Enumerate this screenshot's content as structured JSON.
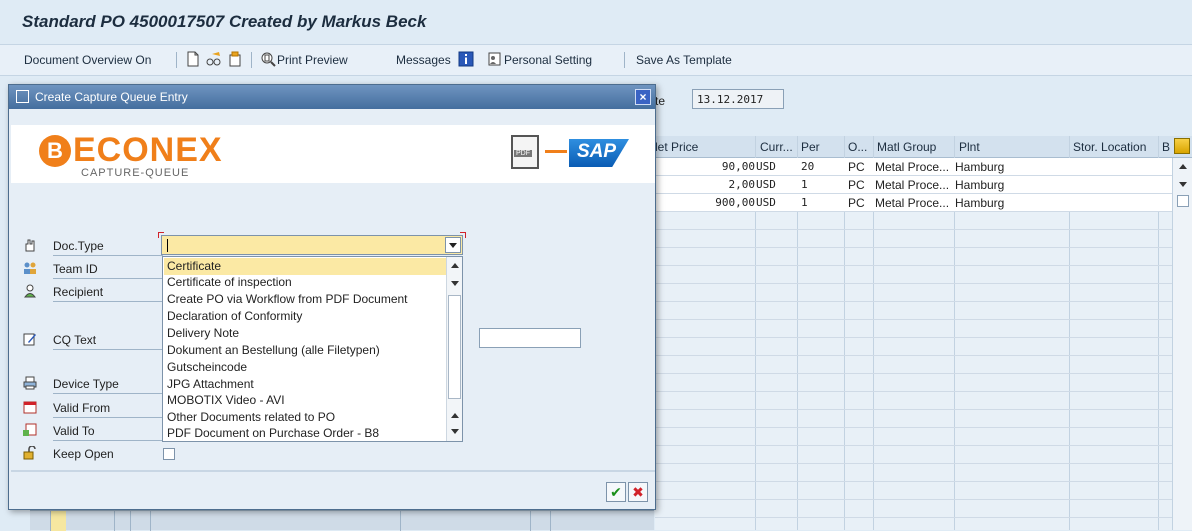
{
  "window": {
    "title": "Standard PO 4500017507 Created by Markus Beck"
  },
  "toolbar": {
    "document_overview": "Document Overview On",
    "print_preview": "Print Preview",
    "messages": "Messages",
    "personal_setting": "Personal Setting",
    "save_as_template": "Save As Template"
  },
  "background": {
    "date_label": "te",
    "date_value": "13.12.2017",
    "grid": {
      "headers": [
        "let Price",
        "Curr...",
        "Per",
        "O...",
        "Matl Group",
        "Plnt",
        "Stor. Location",
        "B"
      ],
      "rows": [
        [
          "90,00",
          "USD",
          "20",
          "PC",
          "Metal Proce...",
          "Hamburg",
          ""
        ],
        [
          "2,00",
          "USD",
          "1",
          "PC",
          "Metal Proce...",
          "Hamburg",
          ""
        ],
        [
          "900,00",
          "USD",
          "1",
          "PC",
          "Metal Proce...",
          "Hamburg",
          ""
        ]
      ]
    }
  },
  "dialog": {
    "title": "Create Capture Queue Entry",
    "close_label": "×",
    "logo": {
      "letter": "B",
      "name": "ECONEX",
      "subtitle": "CAPTURE-QUEUE",
      "pdf_label": "PDF",
      "sap_label": "SAP"
    },
    "fields": {
      "doc_type": "Doc.Type",
      "team_id": "Team ID",
      "recipient": "Recipient",
      "cq_text": "CQ Text",
      "device_type": "Device Type",
      "valid_from": "Valid From",
      "valid_to": "Valid To",
      "keep_open": "Keep Open"
    },
    "doc_type_value": "",
    "dropdown_options": [
      "Certificate",
      "Certificate of inspection",
      "Create PO via Workflow from PDF Document",
      "Declaration of Conformity",
      "Delivery Note",
      "Dokument an Bestellung (alle Filetypen)",
      "Gutscheincode",
      "JPG Attachment",
      "MOBOTIX Video - AVI",
      "Other Documents related to PO",
      "PDF Document on Purchase Order - B8"
    ],
    "selected_option": "Certificate",
    "ok_label": "✔",
    "cancel_label": "✖"
  },
  "colors": {
    "accent": "#f07f1a",
    "selection": "#fbe9a4",
    "titlebar": "#446e9e"
  }
}
